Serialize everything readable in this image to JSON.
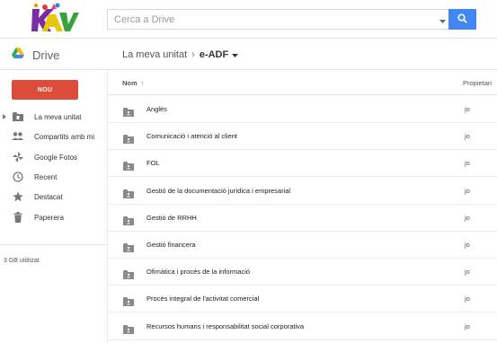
{
  "header": {
    "logo_text": "KAV",
    "search_placeholder": "Cerca a Drive"
  },
  "subbar": {
    "brand_label": "Drive",
    "breadcrumb": {
      "root": "La meva unitat",
      "separator": "›",
      "current": "e-ADF"
    }
  },
  "sidebar": {
    "new_button": "NOU",
    "items": [
      {
        "label": "La meva unitat",
        "icon": "folder-icon"
      },
      {
        "label": "Compartits amb mi",
        "icon": "people-icon"
      },
      {
        "label": "Google Fotos",
        "icon": "pinwheel-icon"
      },
      {
        "label": "Recent",
        "icon": "clock-icon"
      },
      {
        "label": "Destacat",
        "icon": "star-icon"
      },
      {
        "label": "Paperera",
        "icon": "trash-icon"
      }
    ],
    "storage": "3 GB utilitzat"
  },
  "list": {
    "column_name": "Nom",
    "sort_indicator": "↑",
    "column_owner": "Propietari",
    "rows": [
      {
        "name": "Anglès",
        "owner": "jo"
      },
      {
        "name": "Comunicació i atenció al client",
        "owner": "jo"
      },
      {
        "name": "FOL",
        "owner": "jo"
      },
      {
        "name": "Gestió de la documentació jurídica i empresarial",
        "owner": "jo"
      },
      {
        "name": "Gestió de RRHH",
        "owner": "jo"
      },
      {
        "name": "Gestió financera",
        "owner": "jo"
      },
      {
        "name": "Ofimàtica i procés de la informació",
        "owner": "jo"
      },
      {
        "name": "Procés integral de l'activitat comercial",
        "owner": "jo"
      },
      {
        "name": "Recursos humans i responsabilitat social corporativa",
        "owner": "jo"
      }
    ]
  },
  "colors": {
    "accent_blue": "#4285f4",
    "new_red": "#dd4b39",
    "folder_gray": "#8a8a8a",
    "icon_gray": "#777777"
  }
}
